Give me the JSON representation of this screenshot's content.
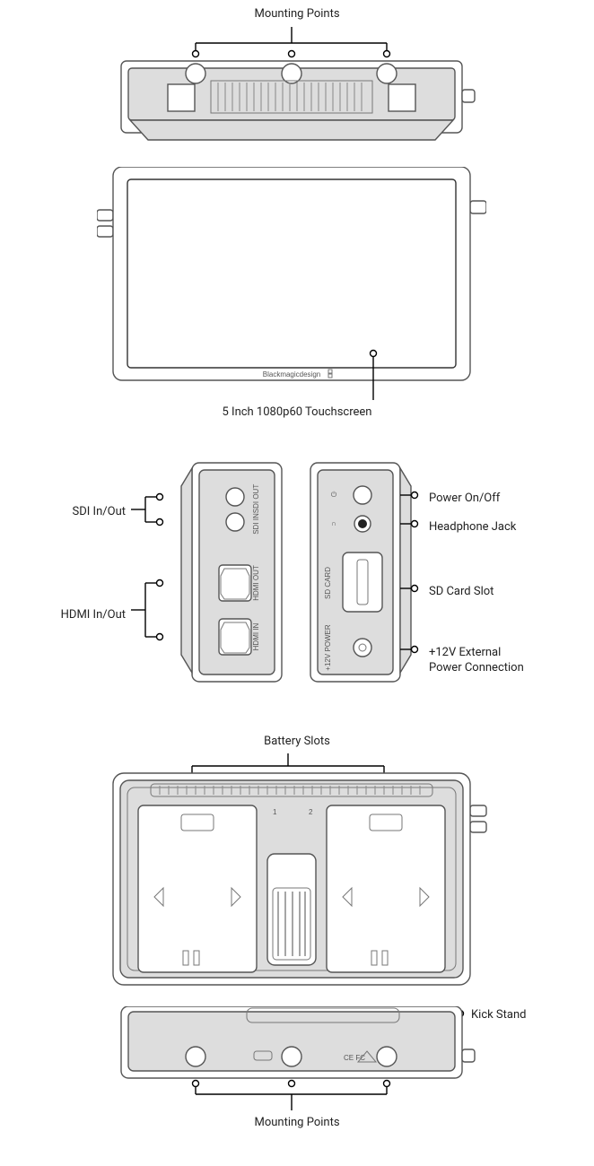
{
  "brand": "Blackmagicdesign",
  "labels": {
    "mounting_top": "Mounting Points",
    "touchscreen": "5 Inch 1080p60 Touchscreen",
    "sdi": "SDI In/Out",
    "hdmi": "HDMI In/Out",
    "power_btn": "Power On/Off",
    "headphone": "Headphone Jack",
    "sdcard": "SD Card Slot",
    "ext_power": "+12V External",
    "ext_power2": "Power Connection",
    "battery": "Battery Slots",
    "kickstand": "Kick Stand",
    "mounting_bottom": "Mounting Points"
  },
  "port_markings": {
    "sdi_out": "SDI OUT",
    "sdi_in": "SDI IN",
    "hdmi_out": "HDMI OUT",
    "hdmi_in": "HDMI IN",
    "sd": "SD CARD",
    "pwr": "+12V POWER"
  },
  "back_markings": {
    "slot1": "1",
    "slot2": "2"
  },
  "compliance": "CE FC"
}
